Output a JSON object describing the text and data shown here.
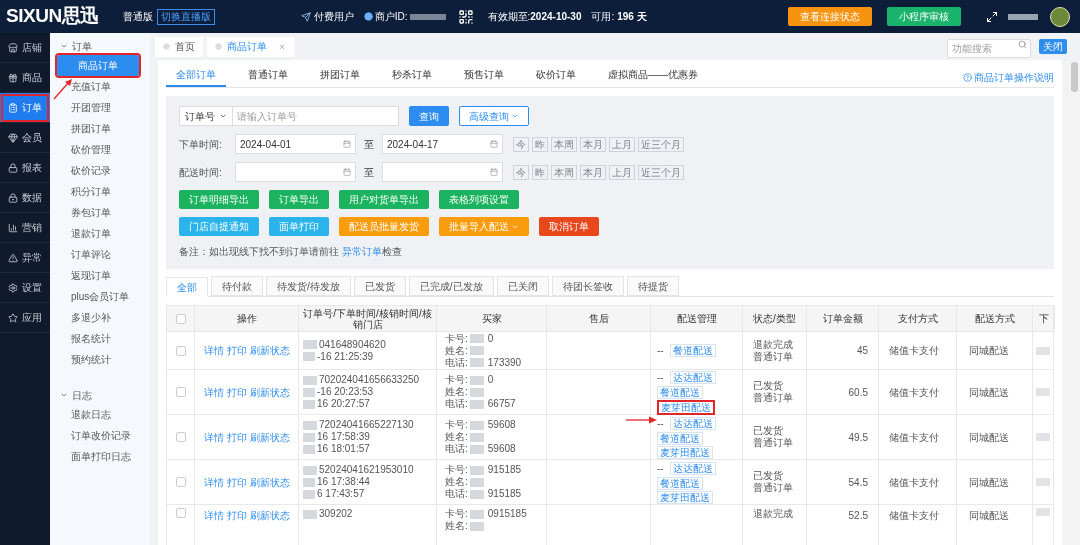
{
  "topbar": {
    "logo": "SIXUN思迅",
    "edition": "普通版",
    "switch_button": "切换直播版",
    "user_type": "付费用户",
    "merchant_label": "商户ID:",
    "expiry_label": "有效期至:",
    "expiry": "2024-10-30",
    "available_label": "可用:",
    "available": "196 天",
    "buttons": [
      {
        "label": "查看连接状态",
        "color": "#f7930e"
      },
      {
        "label": "小程序审核",
        "color": "#19b36b"
      }
    ]
  },
  "rail": [
    {
      "label": "店铺",
      "selected": false,
      "highlighted": false
    },
    {
      "label": "商品",
      "selected": false,
      "highlighted": false
    },
    {
      "label": "订单",
      "selected": true,
      "highlighted": true
    },
    {
      "label": "会员",
      "selected": false,
      "highlighted": false
    },
    {
      "label": "报表",
      "selected": false,
      "highlighted": false
    },
    {
      "label": "数据",
      "selected": false,
      "highlighted": false
    },
    {
      "label": "营销",
      "selected": false,
      "highlighted": false
    },
    {
      "label": "异常",
      "selected": false,
      "highlighted": false
    },
    {
      "label": "设置",
      "selected": false,
      "highlighted": false
    },
    {
      "label": "应用",
      "selected": false,
      "highlighted": false
    }
  ],
  "submenu": [
    {
      "title": "订单",
      "expanded": true,
      "items": [
        {
          "label": "商品订单",
          "selected": true,
          "highlighted": true
        },
        {
          "label": "充值订单",
          "selected": false,
          "highlighted": false
        },
        {
          "label": "开团管理",
          "selected": false,
          "highlighted": false
        },
        {
          "label": "拼团订单",
          "selected": false,
          "highlighted": false
        },
        {
          "label": "砍价管理",
          "selected": false,
          "highlighted": false
        },
        {
          "label": "砍价记录",
          "selected": false,
          "highlighted": false
        },
        {
          "label": "积分订单",
          "selected": false,
          "highlighted": false
        },
        {
          "label": "券包订单",
          "selected": false,
          "highlighted": false
        },
        {
          "label": "退款订单",
          "selected": false,
          "highlighted": false
        },
        {
          "label": "订单评论",
          "selected": false,
          "highlighted": false
        },
        {
          "label": "返现订单",
          "selected": false,
          "highlighted": false
        },
        {
          "label": "plus会员订单",
          "selected": false,
          "highlighted": false
        },
        {
          "label": "多退少补",
          "selected": false,
          "highlighted": false
        },
        {
          "label": "报名统计",
          "selected": false,
          "highlighted": false
        },
        {
          "label": "预约统计",
          "selected": false,
          "highlighted": false
        }
      ]
    },
    {
      "title": "日志",
      "expanded": true,
      "items": [
        {
          "label": "退款日志",
          "selected": false,
          "highlighted": false
        },
        {
          "label": "订单改价记录",
          "selected": false,
          "highlighted": false
        },
        {
          "label": "面单打印日志",
          "selected": false,
          "highlighted": false
        }
      ]
    }
  ],
  "page_tabs": [
    {
      "label": "首页",
      "selected": false,
      "closable": false
    },
    {
      "label": "商品订单",
      "selected": true,
      "closable": true
    }
  ],
  "search": {
    "placeholder": "功能搜索"
  },
  "close_button": "关闭",
  "order_tabs": [
    {
      "label": "全部订单",
      "selected": true
    },
    {
      "label": "普通订单",
      "selected": false
    },
    {
      "label": "拼团订单",
      "selected": false
    },
    {
      "label": "秒杀订单",
      "selected": false
    },
    {
      "label": "预售订单",
      "selected": false
    },
    {
      "label": "砍价订单",
      "selected": false
    },
    {
      "label": "虚拟商品——优惠券",
      "selected": false
    }
  ],
  "help_link": "商品订单操作说明",
  "filter": {
    "type_select": "订单号",
    "order_input": {
      "placeholder": "请输入订单号"
    },
    "query_button": "查询",
    "advanced_button": "高级查询",
    "date_rows": [
      {
        "label": "下单时间:",
        "from": "2024-04-01",
        "to": "2024-04-17",
        "sep": "至",
        "quick": [
          "今",
          "昨",
          "本周",
          "本月",
          "上月",
          "近三个月"
        ]
      },
      {
        "label": "配送时间:",
        "sep": "至",
        "quick": [
          "今",
          "昨",
          "本周",
          "本月",
          "上月",
          "近三个月"
        ]
      }
    ],
    "button_rows": [
      [
        {
          "label": "订单明细导出",
          "color": "#1bb35f",
          "dropdown": false
        },
        {
          "label": "订单导出",
          "color": "#1bb35f",
          "dropdown": false
        },
        {
          "label": "用户对货单导出",
          "color": "#1bb35f",
          "dropdown": false
        },
        {
          "label": "表格列项设置",
          "color": "#1bb35f",
          "dropdown": false
        }
      ],
      [
        {
          "label": "门店自提通知",
          "color": "#2bb4ec",
          "dropdown": false
        },
        {
          "label": "面单打印",
          "color": "#2bb4ec",
          "dropdown": false
        },
        {
          "label": "配送员批量发货",
          "color": "#fa9c0b",
          "dropdown": false
        },
        {
          "label": "批量导入配送",
          "color": "#fa9c0b",
          "dropdown": true
        },
        {
          "label": "取消订单",
          "color": "#e9471c",
          "dropdown": false
        }
      ]
    ],
    "note": "备注：如出现线下找不到订单请前往",
    "note_link": "异常订单",
    "note_end": "检查"
  },
  "status_tabs": [
    {
      "label": "全部",
      "selected": true
    },
    {
      "label": "待付款",
      "selected": false
    },
    {
      "label": "待发货/待发放",
      "selected": false
    },
    {
      "label": "已发货",
      "selected": false
    },
    {
      "label": "已完成/已发放",
      "selected": false
    },
    {
      "label": "已关闭",
      "selected": false
    },
    {
      "label": "待团长签收",
      "selected": false
    },
    {
      "label": "待提货",
      "selected": false
    }
  ],
  "table": {
    "all_checked": false,
    "columns": [
      "操作",
      "订单号/下单时间/核销时间/核销门店",
      "买家",
      "售后",
      "配送管理",
      "状态/类型",
      "订单金额",
      "支付方式",
      "配送方式",
      "下"
    ],
    "rows": [
      {
        "checked": false,
        "actions": [
          "详情",
          "打印",
          "刷新状态"
        ],
        "order": [
          "041648904620",
          "-16 21:25:39"
        ],
        "buyer": [
          {
            "label": "卡号:",
            "value": "0"
          },
          {
            "label": "姓名:"
          },
          {
            "label": "电话:",
            "value": "173390"
          }
        ],
        "delivery_dash": "--",
        "delivery": [
          {
            "label": "餐道配送",
            "highlighted": false
          }
        ],
        "status": [
          "退款完成",
          "普通订单"
        ],
        "amount": "45",
        "payment": "储值卡支付",
        "shipping": "同城配送"
      },
      {
        "checked": false,
        "actions": [
          "详情",
          "打印",
          "刷新状态"
        ],
        "order": [
          "702024041656633250",
          "-16 20:23:53",
          "16 20:27:57"
        ],
        "buyer": [
          {
            "label": "卡号:",
            "value": "0"
          },
          {
            "label": "姓名:"
          },
          {
            "label": "电话:",
            "value": "66757"
          }
        ],
        "delivery_dash": "--",
        "delivery": [
          {
            "label": "达达配送",
            "highlighted": false
          },
          {
            "label": "餐道配送",
            "highlighted": false
          },
          {
            "label": "麦芽田配送",
            "highlighted": true
          }
        ],
        "status": [
          "已发货",
          "普通订单"
        ],
        "amount": "60.5",
        "payment": "储值卡支付",
        "shipping": "同城配送"
      },
      {
        "checked": false,
        "actions": [
          "详情",
          "打印",
          "刷新状态"
        ],
        "order": [
          "72024041665227130",
          "16 17:58:39",
          "16 18:01:57"
        ],
        "buyer": [
          {
            "label": "卡号:",
            "value": "59608"
          },
          {
            "label": "姓名:"
          },
          {
            "label": "电话:",
            "value": "59608"
          }
        ],
        "delivery_dash": "--",
        "delivery": [
          {
            "label": "达达配送",
            "highlighted": false
          },
          {
            "label": "餐道配送",
            "highlighted": false
          },
          {
            "label": "麦芽田配送",
            "highlighted": false
          }
        ],
        "status": [
          "已发货",
          "普通订单"
        ],
        "amount": "49.5",
        "payment": "储值卡支付",
        "shipping": "同城配送"
      },
      {
        "checked": false,
        "actions": [
          "详情",
          "打印",
          "刷新状态"
        ],
        "order": [
          "52024041621953010",
          "16 17:38:44",
          "6 17:43:57"
        ],
        "buyer": [
          {
            "label": "卡号:",
            "value": "915185"
          },
          {
            "label": "姓名:"
          },
          {
            "label": "电话:",
            "value": "915185"
          }
        ],
        "delivery_dash": "--",
        "delivery": [
          {
            "label": "达达配送",
            "highlighted": false
          },
          {
            "label": "餐道配送",
            "highlighted": false
          },
          {
            "label": "麦芽田配送",
            "highlighted": false
          }
        ],
        "status": [
          "已发货",
          "普通订单"
        ],
        "amount": "54.5",
        "payment": "储值卡支付",
        "shipping": "同城配送"
      },
      {
        "checked": false,
        "actions": [
          "详情",
          "打印",
          "刷新状态"
        ],
        "order": [
          "309202"
        ],
        "buyer": [
          {
            "label": "卡号:",
            "value": "0915185"
          },
          {
            "label": "姓名:"
          }
        ],
        "delivery": [],
        "status": [
          "退款完成"
        ],
        "amount": "52.5",
        "payment": "储值卡支付",
        "shipping": "同城配送"
      }
    ]
  }
}
